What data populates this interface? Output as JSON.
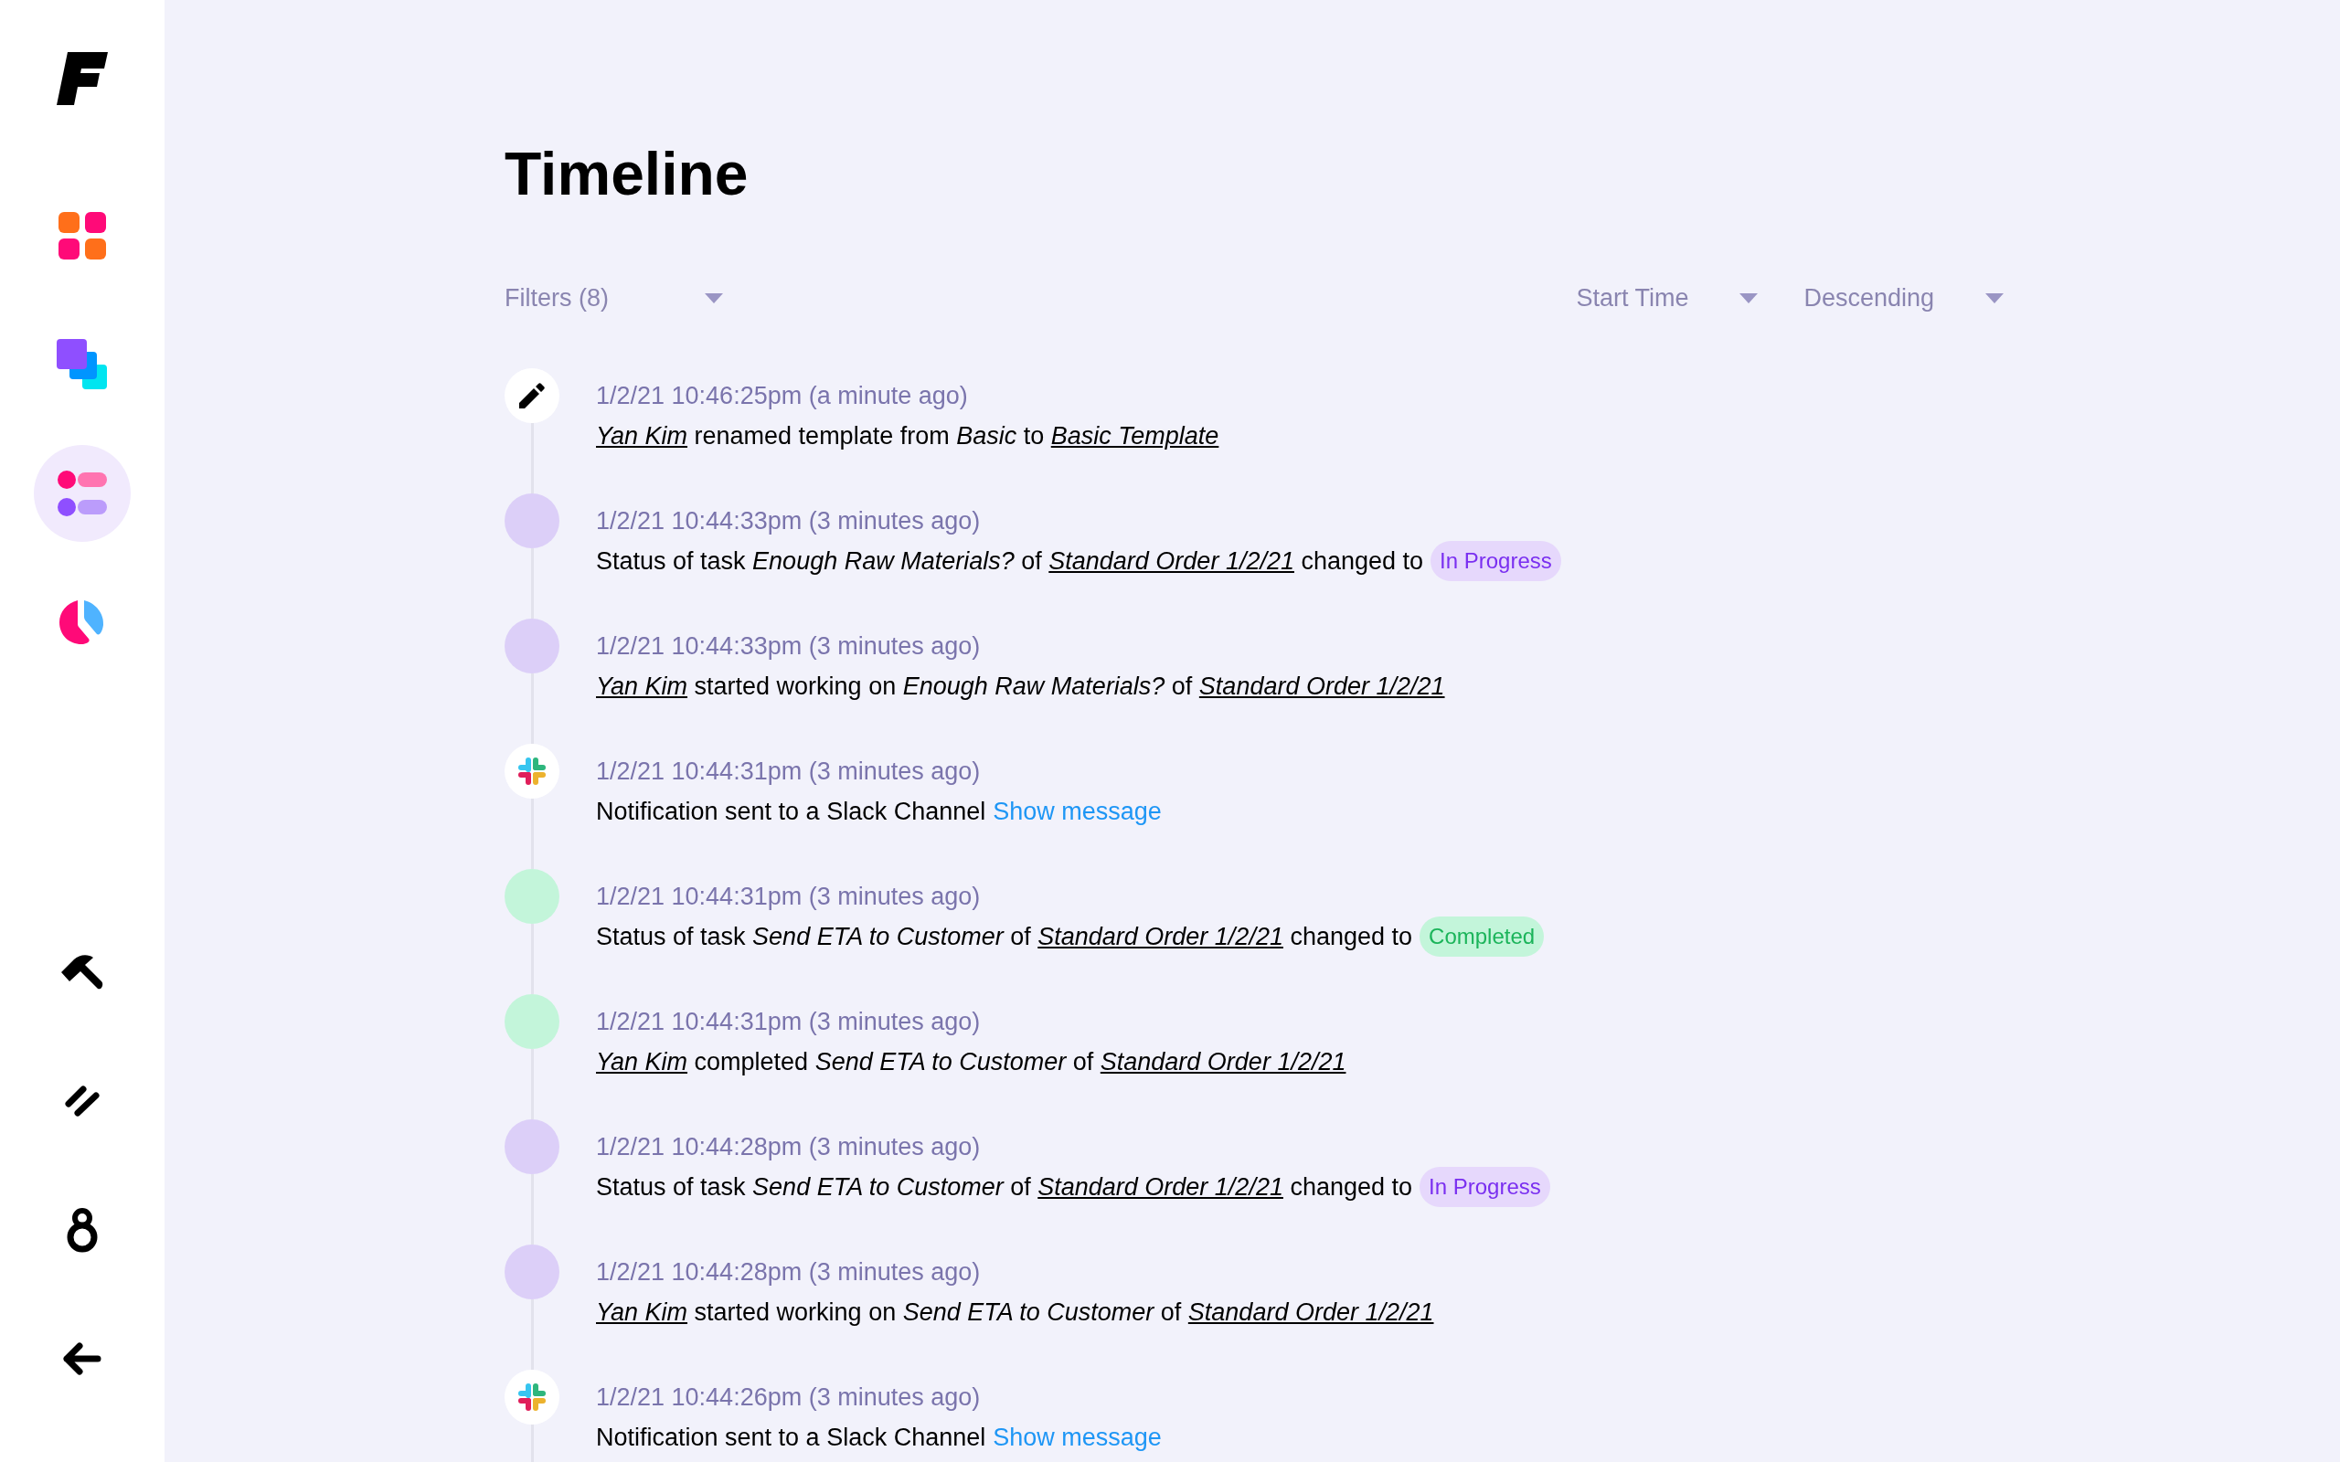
{
  "sidebar": {
    "top_items": [
      {
        "kind": "grid",
        "selected": false
      },
      {
        "kind": "layers",
        "selected": false
      },
      {
        "kind": "list",
        "selected": true
      },
      {
        "kind": "pie",
        "selected": false
      }
    ],
    "bottom_items": [
      {
        "kind": "hammer",
        "selected": false
      },
      {
        "kind": "slashes",
        "selected": false
      },
      {
        "kind": "eight",
        "selected": false
      },
      {
        "kind": "back",
        "selected": false
      }
    ]
  },
  "title": "Timeline",
  "filters": {
    "label": "Filters (8)"
  },
  "sort": [
    {
      "label": "Start Time"
    },
    {
      "label": "Descending"
    }
  ],
  "events": [
    {
      "kind": "edit",
      "time": "1/2/21 10:46:25pm (a minute ago)",
      "parts": [
        {
          "kind": "link",
          "text": "Yan Kim"
        },
        {
          "kind": "text",
          "text": " renamed template from "
        },
        {
          "kind": "italic",
          "text": "Basic"
        },
        {
          "kind": "text",
          "text": " to "
        },
        {
          "kind": "link",
          "text": "Basic Template"
        }
      ]
    },
    {
      "kind": "dot",
      "color": "#dccff8",
      "time": "1/2/21 10:44:33pm (3 minutes ago)",
      "parts": [
        {
          "kind": "text",
          "text": "Status of task "
        },
        {
          "kind": "italic",
          "text": "Enough Raw Materials?"
        },
        {
          "kind": "text",
          "text": " of "
        },
        {
          "kind": "link",
          "text": "Standard Order 1/2/21"
        },
        {
          "kind": "text",
          "text": " changed to"
        }
      ],
      "badge": {
        "text": "In Progress",
        "kind": "in_progress"
      }
    },
    {
      "kind": "dot",
      "color": "#dccff8",
      "time": "1/2/21 10:44:33pm (3 minutes ago)",
      "parts": [
        {
          "kind": "link",
          "text": "Yan Kim"
        },
        {
          "kind": "text",
          "text": " started working on "
        },
        {
          "kind": "italic",
          "text": "Enough Raw Materials?"
        },
        {
          "kind": "text",
          "text": " of "
        },
        {
          "kind": "link",
          "text": "Standard Order 1/2/21"
        }
      ]
    },
    {
      "kind": "slack",
      "time": "1/2/21 10:44:31pm (3 minutes ago)",
      "parts": [
        {
          "kind": "text",
          "text": "Notification sent to a Slack Channel"
        }
      ],
      "action": "Show message"
    },
    {
      "kind": "dot",
      "color": "#c3f5da",
      "time": "1/2/21 10:44:31pm (3 minutes ago)",
      "parts": [
        {
          "kind": "text",
          "text": "Status of task "
        },
        {
          "kind": "italic",
          "text": "Send ETA to Customer"
        },
        {
          "kind": "text",
          "text": " of "
        },
        {
          "kind": "link",
          "text": "Standard Order 1/2/21"
        },
        {
          "kind": "text",
          "text": " changed to"
        }
      ],
      "badge": {
        "text": "Completed",
        "kind": "completed"
      }
    },
    {
      "kind": "dot",
      "color": "#c3f5da",
      "time": "1/2/21 10:44:31pm (3 minutes ago)",
      "parts": [
        {
          "kind": "link",
          "text": "Yan Kim"
        },
        {
          "kind": "text",
          "text": " completed "
        },
        {
          "kind": "italic",
          "text": "Send ETA to Customer"
        },
        {
          "kind": "text",
          "text": " of "
        },
        {
          "kind": "link",
          "text": "Standard Order 1/2/21"
        }
      ]
    },
    {
      "kind": "dot",
      "color": "#dccff8",
      "time": "1/2/21 10:44:28pm (3 minutes ago)",
      "parts": [
        {
          "kind": "text",
          "text": "Status of task "
        },
        {
          "kind": "italic",
          "text": "Send ETA to Customer"
        },
        {
          "kind": "text",
          "text": " of "
        },
        {
          "kind": "link",
          "text": "Standard Order 1/2/21"
        },
        {
          "kind": "text",
          "text": " changed to"
        }
      ],
      "badge": {
        "text": "In Progress",
        "kind": "in_progress"
      }
    },
    {
      "kind": "dot",
      "color": "#dccff8",
      "time": "1/2/21 10:44:28pm (3 minutes ago)",
      "parts": [
        {
          "kind": "link",
          "text": "Yan Kim"
        },
        {
          "kind": "text",
          "text": " started working on "
        },
        {
          "kind": "italic",
          "text": "Send ETA to Customer"
        },
        {
          "kind": "text",
          "text": " of "
        },
        {
          "kind": "link",
          "text": "Standard Order 1/2/21"
        }
      ]
    },
    {
      "kind": "slack",
      "time": "1/2/21 10:44:26pm (3 minutes ago)",
      "parts": [
        {
          "kind": "text",
          "text": "Notification sent to a Slack Channel"
        }
      ],
      "action": "Show message"
    }
  ]
}
